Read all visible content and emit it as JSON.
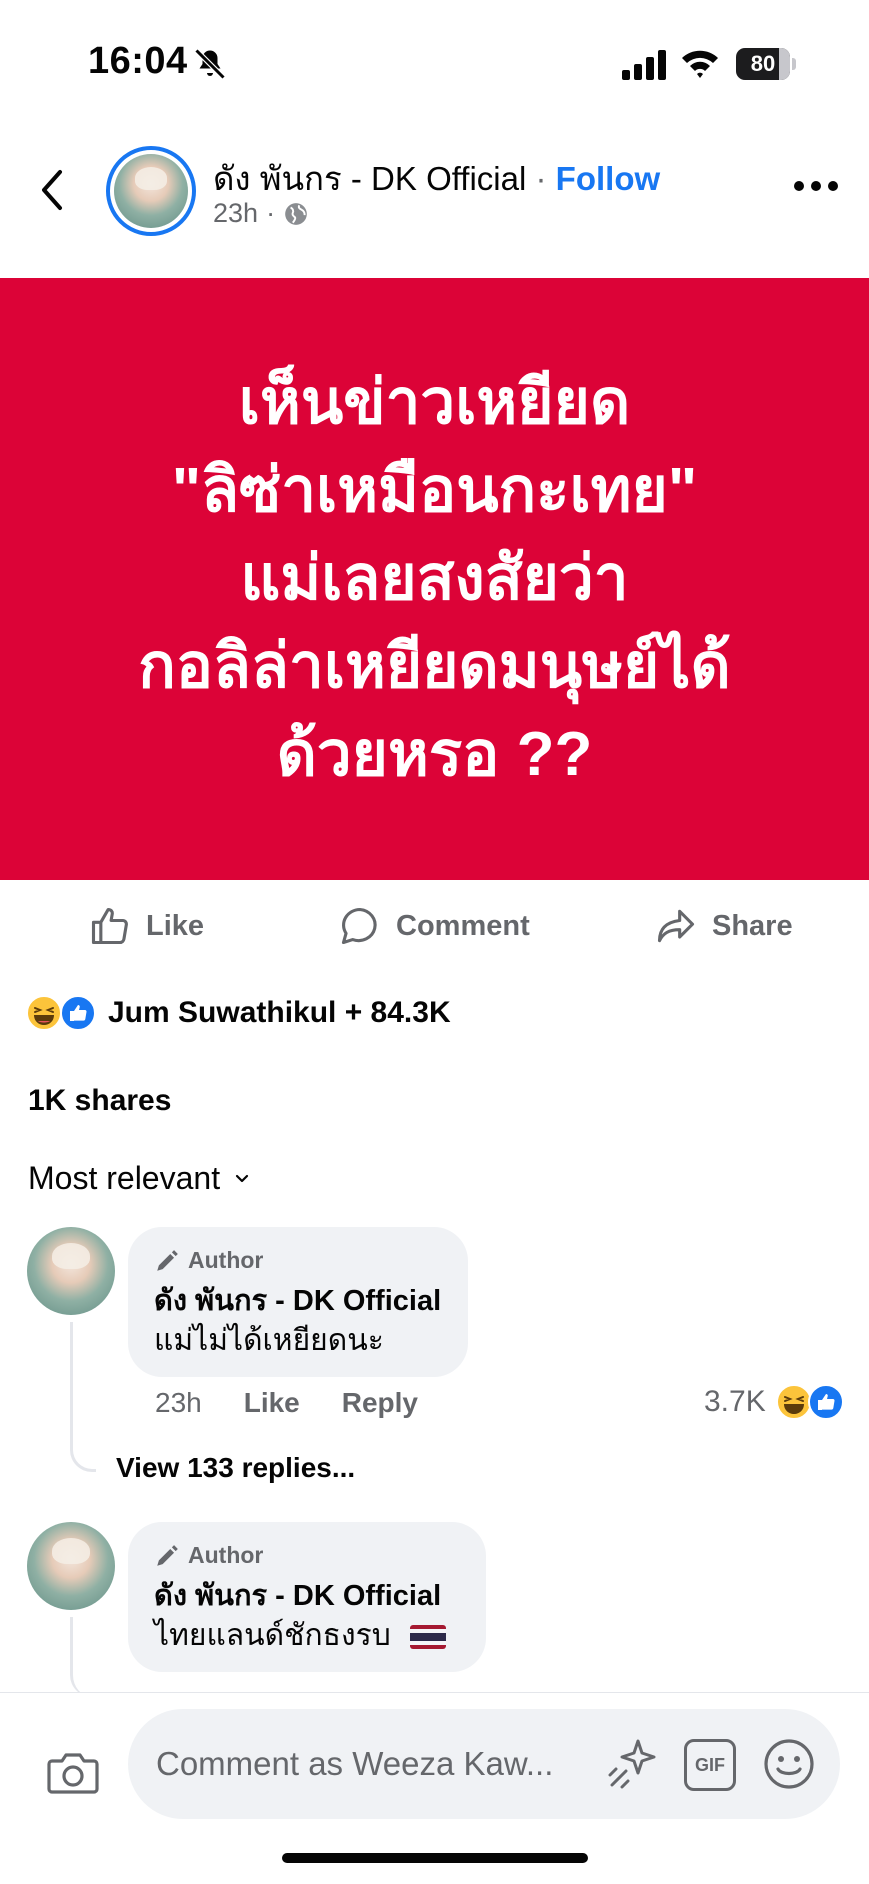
{
  "status_bar": {
    "time": "16:04",
    "battery": "80",
    "battery_level": 0.8,
    "icons": [
      "bell-slash-icon",
      "cellular-signal-icon",
      "wifi-icon",
      "battery-icon"
    ]
  },
  "post_header": {
    "author": "ดัง พันกร - DK Official",
    "separator": "·",
    "follow_label": "Follow",
    "time": "23h",
    "meta_dot": "·",
    "icons": [
      "back-chevron-icon",
      "globe-icon",
      "more-options-icon"
    ]
  },
  "post_image": {
    "lines": [
      "เห็นข่าวเหยียด",
      "\"ลิซ่าเหมือนกะเทย\"",
      "แม่เลยสงสัยว่า",
      "กอลิล่าเหยียดมนุษย์ได้",
      "ด้วยหรอ ??"
    ],
    "background_color": "#dc0337"
  },
  "actions": {
    "like": "Like",
    "comment": "Comment",
    "share": "Share"
  },
  "reactions": {
    "summary": "Jum Suwathikul + 84.3K",
    "icons": [
      "haha-reaction-icon",
      "like-reaction-icon"
    ]
  },
  "shares": "1K shares",
  "sort_label": "Most relevant",
  "comments": [
    {
      "badge": "Author",
      "name": "ดัง พันกร - DK Official",
      "text": "แม่ไม่ได้เหยียดนะ",
      "time": "23h",
      "like": "Like",
      "reply": "Reply",
      "reaction_count": "3.7K",
      "view_replies": "View 133 replies..."
    },
    {
      "badge": "Author",
      "name": "ดัง พันกร - DK Official",
      "text": "ไทยแลนด์ชักธงรบ"
    }
  ],
  "composer": {
    "placeholder": "Comment as Weeza Kaw...",
    "gif_label": "GIF",
    "icons": [
      "camera-icon",
      "sparkle-sticker-icon",
      "gif-icon",
      "emoji-icon"
    ]
  },
  "colors": {
    "accent": "#1877f2",
    "secondary_text": "#65676b",
    "bubble": "#f0f2f5"
  }
}
